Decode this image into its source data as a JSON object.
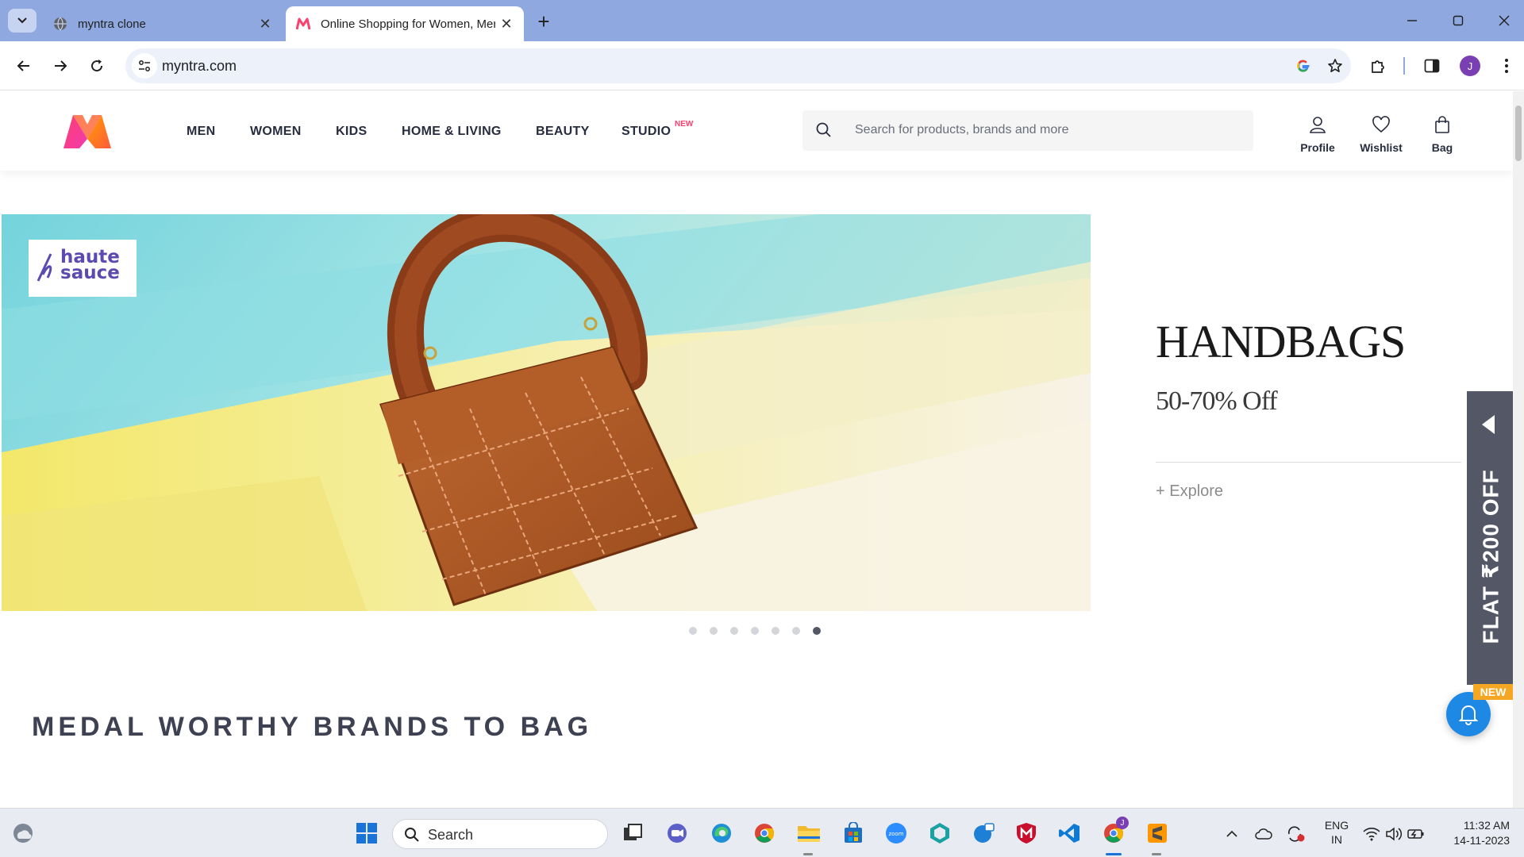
{
  "browser": {
    "tabs": [
      {
        "title": "myntra clone",
        "active": false
      },
      {
        "title": "Online Shopping for Women, Men, Kids Fashion & Lifestyle",
        "active": true
      }
    ],
    "url": "myntra.com",
    "profile_initial": "J"
  },
  "header": {
    "nav": [
      "MEN",
      "WOMEN",
      "KIDS",
      "HOME & LIVING",
      "BEAUTY",
      "STUDIO"
    ],
    "studio_badge": "NEW",
    "search_placeholder": "Search for products, brands and more",
    "actions": {
      "profile": "Profile",
      "wishlist": "Wishlist",
      "bag": "Bag"
    }
  },
  "banner": {
    "brand_logo_text": "haute sauce",
    "title": "HANDBAGS",
    "subtitle": "50-70% Off",
    "explore": "+ Explore",
    "slides_count": 7,
    "active_slide": 7
  },
  "section_title": "MEDAL WORTHY BRANDS TO BAG",
  "offer": {
    "text": "FLAT ₹200 OFF",
    "new_flag": "NEW"
  },
  "taskbar": {
    "search": "Search",
    "lang_line1": "ENG",
    "lang_line2": "IN",
    "time": "11:32 AM",
    "date": "14-11-2023",
    "profile_badge": "J"
  },
  "colors": {
    "tabstrip": "#8fa9e0",
    "accent_pink": "#ff3f6c",
    "nav_text": "#282c3f",
    "offer_tab": "#535766",
    "bell": "#1e88e5",
    "new_flag": "#f5a623"
  }
}
